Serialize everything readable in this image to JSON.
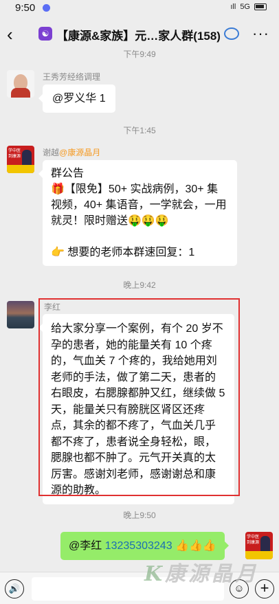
{
  "status_bar": {
    "time": "9:50",
    "network": "5G",
    "signal": "ıll"
  },
  "header": {
    "back_label": "‹",
    "group_icon": "☯",
    "title": "【康源&家族】元…家人群(158)",
    "more_label": "···"
  },
  "timestamps": {
    "t0": "下午9:49",
    "t1": "下午1:45",
    "t2": "晚上9:42",
    "t3": "晚上9:50"
  },
  "messages": [
    {
      "sender": "王秀芳经络调理",
      "text": "@罗义华  1"
    },
    {
      "sender_prefix": "谢越",
      "sender_suffix": "@康源晶月",
      "lines": [
        "群公告",
        "🎁【限免】50+ 实战病例，30+ 集视频，40+ 集语音，一学就会，一用就灵！限时赠送🤑🤑🤑",
        "",
        "👉 想要的老师本群速回复：1"
      ]
    },
    {
      "sender": "李红",
      "text": "给大家分享一个案例，有个 20 岁不孕的患者，她的能量关有 10 个疼的，气血关 7 个疼的，我给她用刘老师的手法，做了第二天，患者的右眼皮，右腮腺都肿又红，继续做 5 天，能量关只有膀胱区肾区还疼点，其余的都不疼了，气血关几乎都不疼了，患者说全身轻松，眼，腮腺也都不肿了。元气开关真的太厉害。感谢刘老师，感谢谢总和康源的助教。"
    },
    {
      "mention": "@李红",
      "phone": "13235303243",
      "emoji": "👍👍👍"
    }
  ],
  "avatar_text": {
    "red": "学中医 到康源"
  },
  "watermark": {
    "mark": "K",
    "text": "康源晶月"
  },
  "bottom_bar": {
    "voice": "🔊",
    "emoji": "☺",
    "plus": "+"
  },
  "colors": {
    "bubble_self": "#95ec69",
    "highlight": "#e03030",
    "sender_highlight": "#f59a23"
  }
}
